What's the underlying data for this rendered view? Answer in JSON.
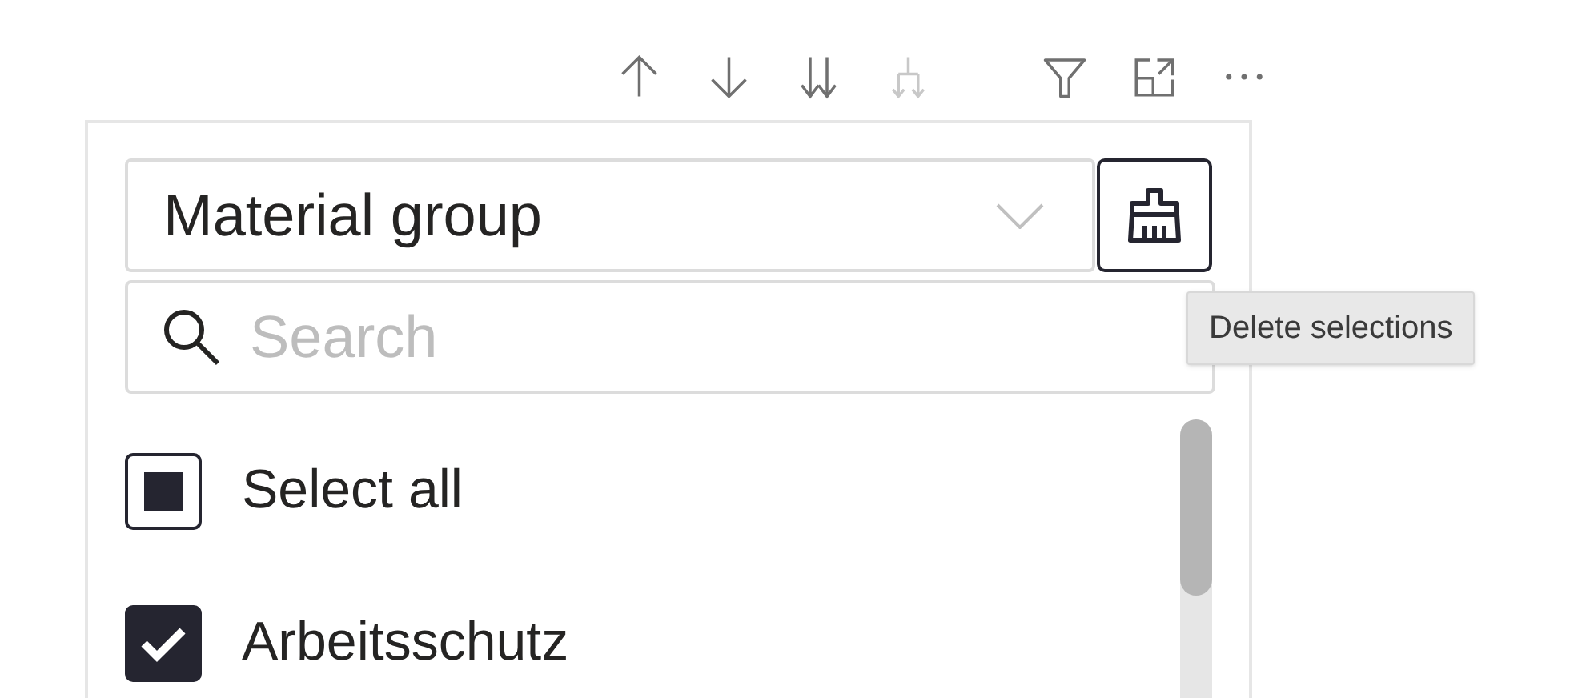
{
  "toolbar": [
    {
      "kind": "up",
      "disabled": false
    },
    {
      "kind": "down",
      "disabled": false
    },
    {
      "kind": "double-down",
      "disabled": false
    },
    {
      "kind": "hierarchy",
      "disabled": true
    },
    {
      "kind": "filter",
      "disabled": false
    },
    {
      "kind": "expand",
      "disabled": false
    },
    {
      "kind": "more",
      "disabled": false
    }
  ],
  "slicer": {
    "dropdown": {
      "value": "Material group"
    },
    "clear_button": {
      "tooltip": "Delete selections"
    },
    "search": {
      "placeholder": "Search"
    },
    "items": [
      {
        "label": "Select all",
        "checked": false,
        "indeterminate": true
      },
      {
        "label": "Arbeitsschutz",
        "checked": true,
        "indeterminate": false
      }
    ]
  }
}
